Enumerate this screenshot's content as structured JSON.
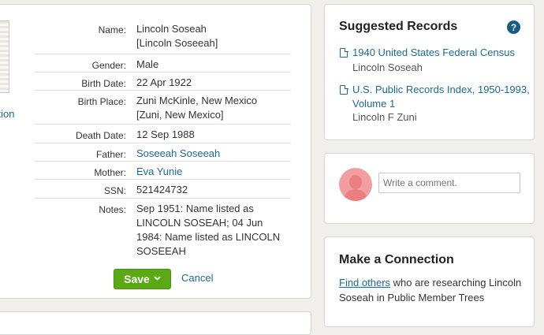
{
  "record": {
    "image_link": "nation",
    "fields": [
      {
        "label": "Name:",
        "value": "Lincoln Soseah",
        "value2": "[Lincoln Soseeah]"
      },
      {
        "label": "Gender:",
        "value": "Male"
      },
      {
        "label": "Birth Date:",
        "value": "22 Apr 1922"
      },
      {
        "label": "Birth Place:",
        "value": "Zuni McKinle, New Mexico",
        "value2": "[Zuni, New Mexico]"
      },
      {
        "label": "Death Date:",
        "value": "12 Sep 1988"
      },
      {
        "label": "Father:",
        "value": "Soseeah Soseeah"
      },
      {
        "label": "Mother:",
        "value": "Eva Yunie"
      },
      {
        "label": "SSN:",
        "value": "521424732"
      },
      {
        "label": "Notes:",
        "value": "Sep 1951: Name listed as LINCOLN SOSEAH; 04 Jun 1984: Name listed as LINCOLN SOSEEAH"
      }
    ],
    "save_label": "Save",
    "cancel_label": "Cancel"
  },
  "suggested": {
    "title": "Suggested Records",
    "help": "?",
    "items": [
      {
        "title": "1940 United States Federal Census",
        "sub": "Lincoln Soseah"
      },
      {
        "title": "U.S. Public Records Index, 1950-1993, Volume 1",
        "sub": "Lincoln F Zuni"
      }
    ]
  },
  "comment": {
    "placeholder": "Write a comment."
  },
  "connection": {
    "title": "Make a Connection",
    "link": "Find others",
    "text": " who are researching Lincoln Soseah in Public Member Trees"
  },
  "colors": {
    "link": "#1b6a93",
    "save": "#5ba915",
    "help": "#1a5b82",
    "avatar": "#f09ea0"
  },
  "icons": [
    "document-icon",
    "help-icon",
    "chevron-down-icon",
    "avatar-icon"
  ]
}
